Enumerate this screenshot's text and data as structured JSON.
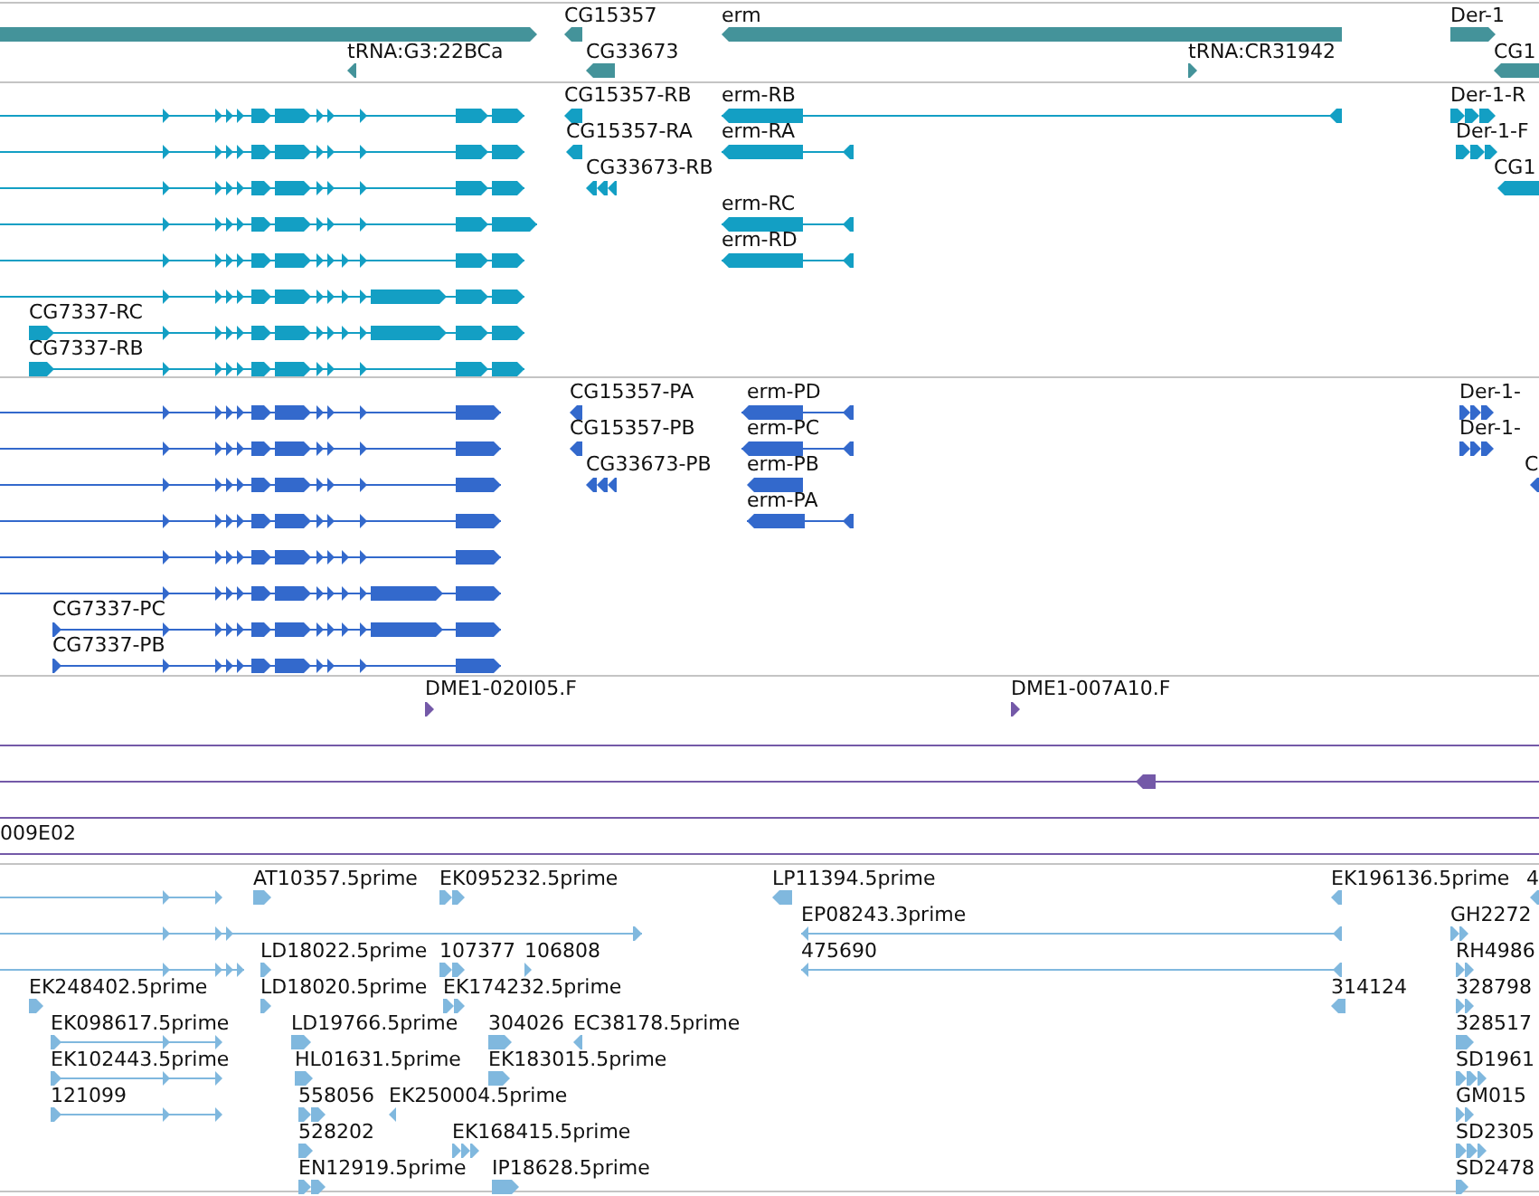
{
  "tracks": [
    {
      "color": "#44939a",
      "features": [
        {
          "reverse_strand": false
        },
        {
          "label": "CG15357",
          "reverse_strand": true
        },
        {
          "label": "erm",
          "reverse_strand": true
        },
        {
          "label": "Der-1",
          "reverse_strand": false
        },
        {
          "label": "tRNA:G3:22BCa",
          "reverse_strand": true
        },
        {
          "label": "CG33673",
          "reverse_strand": true
        },
        {
          "label": "tRNA:CR31942",
          "reverse_strand": false
        },
        {
          "label": "CG1",
          "reverse_strand": true
        }
      ]
    },
    {
      "color": "#139fc4",
      "features": [
        {
          "reverse_strand": false
        },
        {
          "label": "CG15357-RB",
          "reverse_strand": true
        },
        {
          "label": "erm-RB",
          "reverse_strand": true
        },
        {
          "label": "Der-1-R",
          "reverse_strand": false
        },
        {
          "reverse_strand": false
        },
        {
          "label": "CG15357-RA",
          "reverse_strand": true
        },
        {
          "label": "erm-RA",
          "reverse_strand": true
        },
        {
          "label": "Der-1-F",
          "reverse_strand": false
        },
        {
          "reverse_strand": false
        },
        {
          "label": "CG33673-RB",
          "reverse_strand": true
        },
        {
          "label": "CG1",
          "reverse_strand": true
        },
        {
          "reverse_strand": false
        },
        {
          "label": "erm-RC",
          "reverse_strand": true
        },
        {
          "reverse_strand": false
        },
        {
          "label": "erm-RD",
          "reverse_strand": true
        },
        {
          "reverse_strand": false
        },
        {
          "label": "CG7337-RC",
          "reverse_strand": false
        },
        {
          "label": "CG7337-RB",
          "reverse_strand": false
        }
      ]
    },
    {
      "color": "#3369cc",
      "features": [
        {
          "reverse_strand": false
        },
        {
          "label": "CG15357-PA",
          "reverse_strand": true
        },
        {
          "label": "erm-PD",
          "reverse_strand": true
        },
        {
          "label": "Der-1-",
          "reverse_strand": false
        },
        {
          "reverse_strand": false
        },
        {
          "label": "CG15357-PB",
          "reverse_strand": true
        },
        {
          "label": "erm-PC",
          "reverse_strand": true
        },
        {
          "label": "Der-1-",
          "reverse_strand": false
        },
        {
          "reverse_strand": false
        },
        {
          "label": "CG33673-PB",
          "reverse_strand": true
        },
        {
          "label": "erm-PB",
          "reverse_strand": true
        },
        {
          "label": "C",
          "reverse_strand": true
        },
        {
          "reverse_strand": false
        },
        {
          "label": "erm-PA",
          "reverse_strand": true
        },
        {
          "reverse_strand": false
        },
        {
          "reverse_strand": false
        },
        {
          "label": "CG7337-PC",
          "reverse_strand": false
        },
        {
          "label": "CG7337-PB",
          "reverse_strand": false
        }
      ]
    },
    {
      "color": "#7459a8",
      "features": [
        {
          "label": "DME1-020I05.F",
          "kind": "read",
          "reverse_strand": false
        },
        {
          "label": "DME1-007A10.F",
          "kind": "read",
          "reverse_strand": false
        },
        {
          "kind": "span"
        },
        {
          "kind": "span",
          "reverse_strand": true
        },
        {
          "kind": "span"
        },
        {
          "label": "009E02",
          "kind": "span"
        }
      ]
    },
    {
      "color": "#80b8de",
      "features": [
        {
          "reverse_strand": false
        },
        {
          "label": "AT10357.5prime",
          "reverse_strand": false
        },
        {
          "label": "EK095232.5prime",
          "reverse_strand": false
        },
        {
          "label": "LP11394.5prime",
          "reverse_strand": true
        },
        {
          "label": "EK196136.5prime",
          "reverse_strand": true
        },
        {
          "label": "4",
          "reverse_strand": true
        },
        {
          "reverse_strand": false
        },
        {
          "label": "EP08243.3prime",
          "reverse_strand": true
        },
        {
          "label": "GH2272",
          "reverse_strand": false
        },
        {
          "reverse_strand": false
        },
        {
          "label": "LD18022.5prime",
          "reverse_strand": false
        },
        {
          "label": "107377",
          "reverse_strand": false
        },
        {
          "label": "106808",
          "reverse_strand": false
        },
        {
          "label": "475690",
          "reverse_strand": true
        },
        {
          "label": "RH4986",
          "reverse_strand": false
        },
        {
          "label": "EK248402.5prime",
          "reverse_strand": false
        },
        {
          "label": "LD18020.5prime",
          "reverse_strand": false
        },
        {
          "label": "EK174232.5prime",
          "reverse_strand": false
        },
        {
          "label": "314124",
          "reverse_strand": true
        },
        {
          "label": "328798",
          "reverse_strand": false
        },
        {
          "label": "EK098617.5prime",
          "reverse_strand": false
        },
        {
          "label": "LD19766.5prime",
          "reverse_strand": false
        },
        {
          "label": "304026",
          "reverse_strand": false
        },
        {
          "label": "EC38178.5prime",
          "reverse_strand": true
        },
        {
          "label": "328517",
          "reverse_strand": false
        },
        {
          "label": "EK102443.5prime",
          "reverse_strand": false
        },
        {
          "label": "HL01631.5prime",
          "reverse_strand": false
        },
        {
          "label": "EK183015.5prime",
          "reverse_strand": false
        },
        {
          "label": "SD1961",
          "reverse_strand": false
        },
        {
          "label": "121099",
          "reverse_strand": false
        },
        {
          "label": "558056",
          "reverse_strand": false
        },
        {
          "label": "EK250004.5prime",
          "reverse_strand": true
        },
        {
          "label": "GM015",
          "reverse_strand": false
        },
        {
          "label": "528202",
          "reverse_strand": false
        },
        {
          "label": "EK168415.5prime",
          "reverse_strand": false
        },
        {
          "label": "SD2305",
          "reverse_strand": false
        },
        {
          "label": "EN12919.5prime",
          "reverse_strand": false
        },
        {
          "label": "IP18628.5prime",
          "reverse_strand": false
        },
        {
          "label": "SD2478",
          "reverse_strand": false
        }
      ]
    }
  ]
}
